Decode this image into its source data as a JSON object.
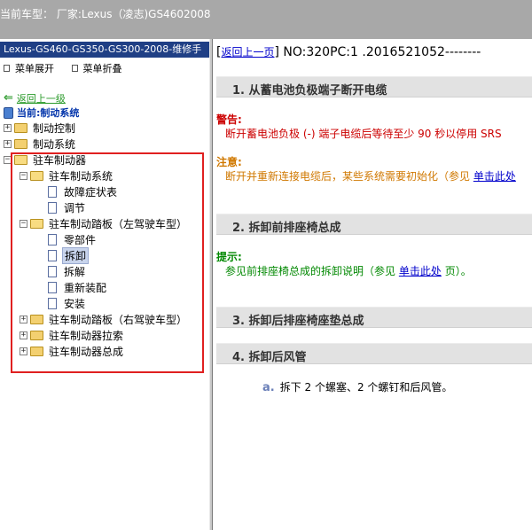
{
  "header": {
    "current_model": "当前车型：  厂家:Lexus（凌志)GS4602008"
  },
  "sidebar": {
    "manual_title": "Lexus-GS460-GS350-GS300-2008-维修手",
    "expand_menu": "菜单展开",
    "collapse_menu": "菜单折叠",
    "back": "返回上一级",
    "current": "当前:制动系统",
    "tree": {
      "brake_control": "制动控制",
      "brake_system": "制动系统",
      "parking_brake": "驻车制动器",
      "pb_system": "驻车制动系统",
      "symptoms": "故障症状表",
      "adjust": "调节",
      "pb_pedal_lhd": "驻车制动踏板（左驾驶车型）",
      "parts": "零部件",
      "removal": "拆卸",
      "disassembly": "拆解",
      "reassembly": "重新装配",
      "install": "安装",
      "pb_pedal_rhd": "驻车制动踏板（右驾驶车型）",
      "pb_cable": "驻车制动器拉索",
      "pb_assembly": "驻车制动器总成"
    }
  },
  "content": {
    "back_link": "返回上一页",
    "doc_number": "NO:320PC:1 .2016521052--------",
    "s1": "1. 从蓄电池负极端子断开电缆",
    "warning_label": "警告:",
    "warning_text": "断开蓄电池负极 (-) 端子电缆后等待至少 90 秒以停用 SRS",
    "note_label": "注意:",
    "note_text": "断开并重新连接电缆后，某些系统需要初始化（参见",
    "note_link": "单击此处",
    "s2": "2. 拆卸前排座椅总成",
    "hint_label": "提示:",
    "hint_text": "参见前排座椅总成的拆卸说明（参见",
    "hint_link": "单击此处",
    "hint_suffix": "页）。",
    "s3": "3. 拆卸后排座椅座垫总成",
    "s4": "4. 拆卸后风管",
    "step_a_letter": "a.",
    "step_a_text": "拆下 2 个螺塞、2 个螺钉和后风管。"
  }
}
